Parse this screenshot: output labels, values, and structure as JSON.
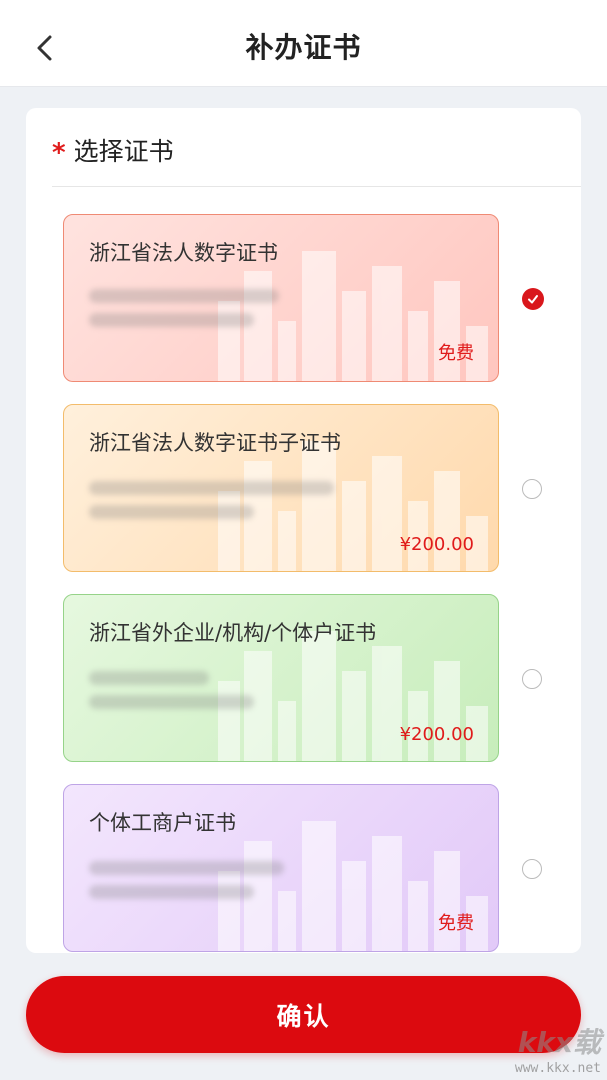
{
  "header": {
    "title": "补办证书",
    "back_icon": "chevron-left-icon"
  },
  "section": {
    "required_mark": "*",
    "title": "选择证书"
  },
  "certificates": [
    {
      "title": "浙江省法人数字证书",
      "price": "免费",
      "selected": true,
      "theme": {
        "bg_from": "#ffe3df",
        "bg_to": "#ffc6bf",
        "border": "#ef8a74"
      }
    },
    {
      "title": "浙江省法人数字证书子证书",
      "price": "¥200.00",
      "selected": false,
      "theme": {
        "bg_from": "#fff0dc",
        "bg_to": "#ffd9ac",
        "border": "#f3bc6b"
      }
    },
    {
      "title": "浙江省外企业/机构/个体户证书",
      "price": "¥200.00",
      "selected": false,
      "theme": {
        "bg_from": "#e6f8df",
        "bg_to": "#c7edbb",
        "border": "#96d389"
      }
    },
    {
      "title": "个体工商户证书",
      "price": "免费",
      "selected": false,
      "theme": {
        "bg_from": "#f3e6fd",
        "bg_to": "#e2c9f8",
        "border": "#bea4e6"
      }
    }
  ],
  "confirm": {
    "label": "确认"
  },
  "watermark": {
    "logo": "kkx载",
    "url": "www.kkx.net"
  },
  "colors": {
    "accent": "#dc0a0f",
    "price": "#e01b1b"
  }
}
